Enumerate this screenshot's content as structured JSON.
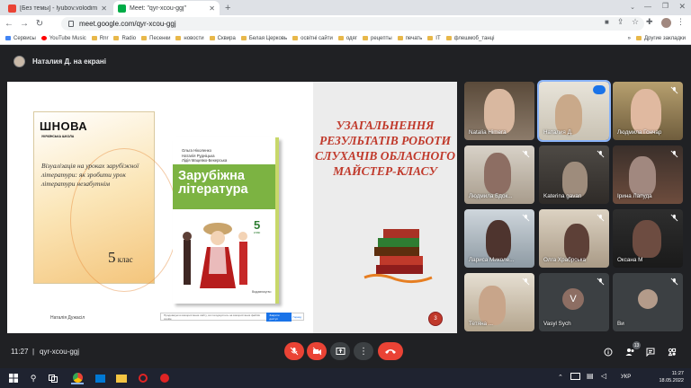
{
  "browser": {
    "tabs": [
      {
        "label": "[Без темы] - lyubov.volodimirivn",
        "active": false
      },
      {
        "label": "Meet: \"qyr-xcou-ggj\"",
        "active": true
      }
    ],
    "new_tab": "+",
    "address": "meet.google.com/qyr-xcou-ggj",
    "bookmarks": [
      "Сервисы",
      "YouTube Music",
      "Rnr",
      "Radio",
      "Песенки",
      "новости",
      "Сквира",
      "Белая Церковь",
      "освітні сайти",
      "одяг",
      "рецепты",
      "печать",
      "IT",
      "флешмоб_танці"
    ],
    "bookmarks_more": "»",
    "other_bookmarks": "Другие закладки"
  },
  "meet": {
    "presenter_label": "Наталия Д. на екрані",
    "slide": {
      "title": "УЗАГАЛЬНЕННЯ РЕЗУЛЬТАТІВ РОБОТИ СЛУХАЧІВ ОБЛАСНОГО МАЙСТЕР-КЛАСУ",
      "book1_logo": "ШНОВА",
      "book1_sub": "УКРАЇНСЬКА ШКОЛА",
      "book1_desc": "Візуалізація на уроках зарубіжної літератури: як зробити урок літератури незабутнім",
      "book1_grade_num": "5",
      "book1_grade_word": "клас",
      "author": "Наталія Дужасіл",
      "book2_authors": "Ольга Ніколенко\nНаталія Рудніцька\nЛідія Мацевко-Бекерська",
      "book2_title": "Зарубіжна література",
      "book2_grade": "5",
      "book2_class": "клас",
      "book2_publisher": "Видавництво",
      "consent_text": "Продовжуючи використання сайту, ви погоджуєтесь на використання файлів cookie",
      "consent_button": "Закрити доступ",
      "consent_ok": "Гаразд",
      "page_number": "3"
    },
    "participants": [
      {
        "name": "Natalia Himera"
      },
      {
        "name": "Наталия Д."
      },
      {
        "name": "Людмила Гончар"
      },
      {
        "name": "Людмила Бдок..."
      },
      {
        "name": "Katerina gavan"
      },
      {
        "name": "Ірина Лапуда"
      },
      {
        "name": "Лариса Миколе..."
      },
      {
        "name": "Олга Храбрська"
      },
      {
        "name": "Оксана М"
      },
      {
        "name": "Тетяна ..."
      },
      {
        "name": "Vasyl Sych",
        "initial": "V"
      },
      {
        "name": "Ви"
      }
    ],
    "time": "11:27",
    "separator": "|",
    "meeting_code": "qyr-xcou-ggj",
    "participant_count": "13"
  },
  "taskbar": {
    "lang": "УКР",
    "time": "11:27",
    "date": "18.05.2022"
  },
  "colors": {
    "meet_bg": "#202124",
    "red_button": "#ea4335",
    "slide_title": "#c0392b"
  }
}
